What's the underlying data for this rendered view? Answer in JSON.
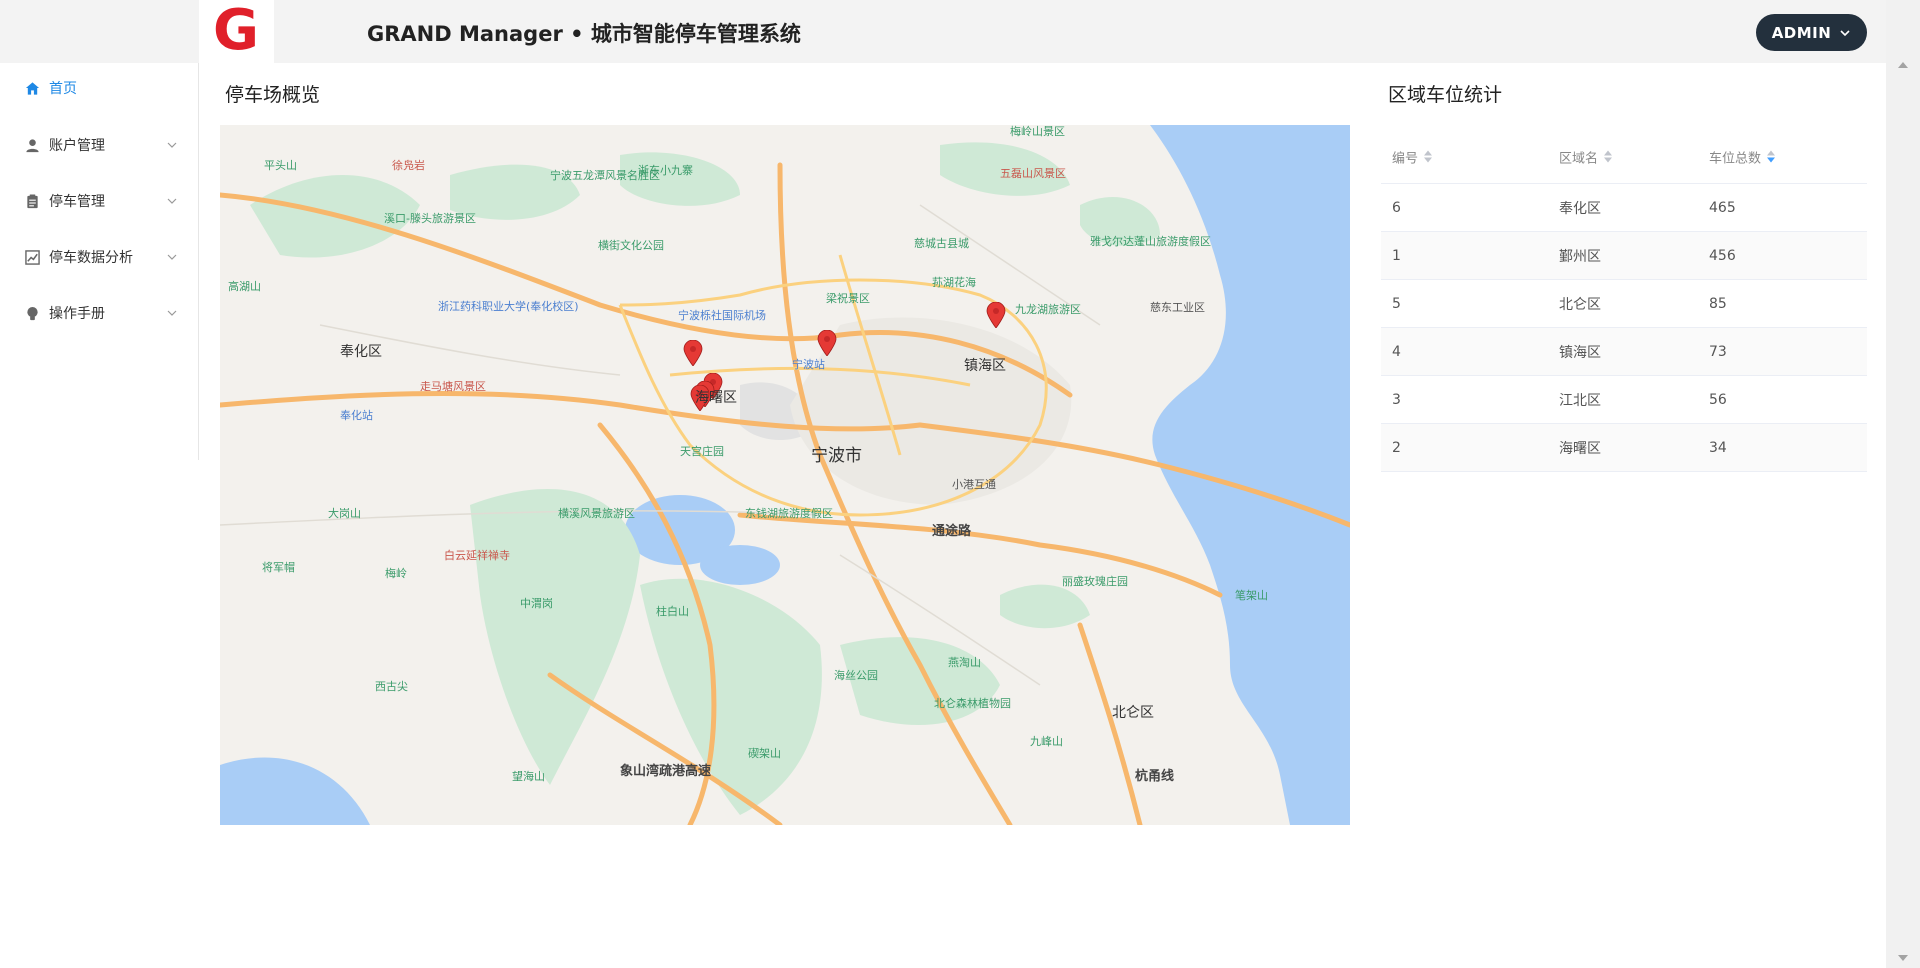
{
  "header": {
    "logo_letter": "G",
    "title": "GRAND Manager • 城市智能停车管理系统",
    "user_label": "ADMIN"
  },
  "sidebar": {
    "items": [
      {
        "label": "首页",
        "icon": "home-icon",
        "active": true
      },
      {
        "label": "账户管理",
        "icon": "user-icon"
      },
      {
        "label": "停车管理",
        "icon": "clipboard-icon"
      },
      {
        "label": "停车数据分析",
        "icon": "chart-icon"
      },
      {
        "label": "操作手册",
        "icon": "bulb-icon"
      }
    ]
  },
  "map_section": {
    "title": "停车场概览",
    "labels": {
      "fenghua": "奉化区",
      "ningbo": "宁波市",
      "zhenhai": "镇海区",
      "beilun": "北仑区",
      "haishu": "海曙区",
      "airport": "宁波栎社国际机场",
      "station": "宁波站",
      "fenghua_station": "奉化站",
      "xiaogang": "小港互通",
      "tongtu": "通途路",
      "hangyong": "杭甬线",
      "xiangshan": "象山湾疏港高速",
      "tiangong": "天宫庄园",
      "dongqian": "东钱湖旅游度假区",
      "hengxi": "横溪风景旅游区",
      "jiulong": "九龙湖旅游区",
      "wulei": "五磊山风景区",
      "cixi_old": "慈城古县城",
      "liangzhu": "梁祝景区",
      "huanghu": "荪湖花海",
      "hengjie": "横街文化公园",
      "zhejiang_college": "浙江药科职业大学(奉化校区)",
      "zouma": "走马塘风景区",
      "dagang": "大岗山",
      "jiangjun": "将军帽",
      "meiling": "梅岭",
      "zhongyong": "中渭岗",
      "zhubai": "柱白山",
      "haisi": "海丝公园",
      "yanhai": "燕淘山",
      "beilun_forest": "北仑森林植物园",
      "jiufeng": "九峰山",
      "duijia": "碶架山",
      "xigu": "西古尖",
      "wangding": "望海山",
      "baiyun": "白云延祥禅寺",
      "xikou": "溪口-滕头旅游景区",
      "gaohu": "高湖山",
      "pingtou": "平头山",
      "xuhuang": "徐凫岩",
      "wulong": "宁波五龙潭风景名胜区",
      "zhedong": "浙东小九寨",
      "lihua": "丽盛玫瑰庄园",
      "bijia": "笔架山",
      "yage": "雅戈尔达蓬山旅游度假区",
      "cixi_ind": "慈东工业区",
      "meiling_scenic": "梅岭山景区"
    },
    "markers": 6
  },
  "table_section": {
    "title": "区域车位统计",
    "columns": [
      "编号",
      "区域名",
      "车位总数"
    ],
    "rows": [
      {
        "id": "6",
        "name": "奉化区",
        "total": "465"
      },
      {
        "id": "1",
        "name": "鄞州区",
        "total": "456"
      },
      {
        "id": "5",
        "name": "北仑区",
        "total": "85"
      },
      {
        "id": "4",
        "name": "镇海区",
        "total": "73"
      },
      {
        "id": "3",
        "name": "江北区",
        "total": "56"
      },
      {
        "id": "2",
        "name": "海曙区",
        "total": "34"
      }
    ]
  },
  "colors": {
    "brand": "#e0202a",
    "accent": "#1e88e5",
    "header_btn": "#23303d",
    "marker": "#e53935",
    "water": "#a9cdf6",
    "green": "#cfe9d6",
    "road": "#f7b76c"
  }
}
